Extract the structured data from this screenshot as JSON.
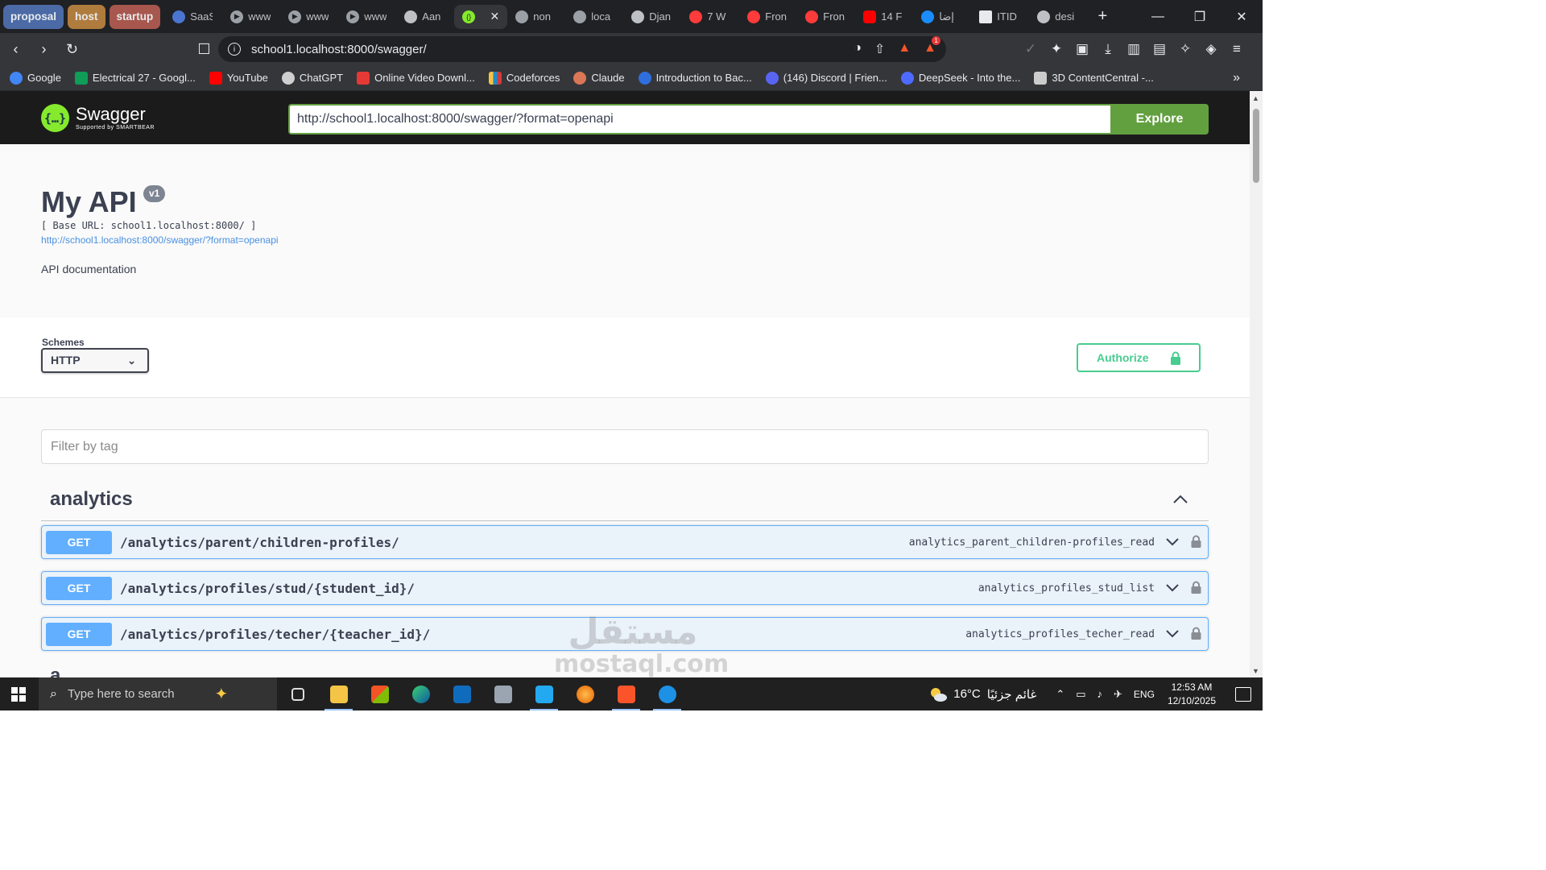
{
  "browser": {
    "tab_groups": [
      {
        "label": "proposal",
        "color": "#4b6aa6"
      },
      {
        "label": "host",
        "color": "#b07c3e"
      },
      {
        "label": "startup",
        "color": "#a7574d"
      }
    ],
    "tabs": [
      {
        "title": "SaaS",
        "icon": "saas-icon"
      },
      {
        "title": "www",
        "icon": "video-icon"
      },
      {
        "title": "www",
        "icon": "video-icon"
      },
      {
        "title": "www",
        "icon": "video-icon"
      },
      {
        "title": "Aan",
        "icon": "openai-icon"
      },
      {
        "title": "",
        "icon": "swagger-icon",
        "active": true
      },
      {
        "title": "non",
        "icon": "globe-icon"
      },
      {
        "title": "loca",
        "icon": "globe-icon"
      },
      {
        "title": "Djan",
        "icon": "openai-icon"
      },
      {
        "title": "7 W",
        "icon": "youtube-icon"
      },
      {
        "title": "Fron",
        "icon": "youtube-icon"
      },
      {
        "title": "Fron",
        "icon": "youtube-icon"
      },
      {
        "title": "14 F",
        "icon": "youtube-icon"
      },
      {
        "title": "إضا",
        "icon": "circle-icon"
      },
      {
        "title": "ITID",
        "icon": "itida-icon"
      },
      {
        "title": "desi",
        "icon": "openai-icon"
      }
    ],
    "url": "school1.localhost:8000/swagger/",
    "bookmarks": [
      {
        "label": "Google",
        "color": "#4285f4"
      },
      {
        "label": "Electrical 27 - Googl...",
        "color": "#0f9d58"
      },
      {
        "label": "YouTube",
        "color": "#ff0000"
      },
      {
        "label": "ChatGPT",
        "color": "#cfcfcf"
      },
      {
        "label": "Online Video Downl...",
        "color": "#e53935"
      },
      {
        "label": "Codeforces",
        "color": "#1f8acb"
      },
      {
        "label": "Claude",
        "color": "#d97757"
      },
      {
        "label": "Introduction to Bac...",
        "color": "#2f6fdd"
      },
      {
        "label": "(146) Discord | Frien...",
        "color": "#5865f2"
      },
      {
        "label": "DeepSeek - Into the...",
        "color": "#4d6bfe"
      },
      {
        "label": "3D ContentCentral -...",
        "color": "#cccccc"
      }
    ],
    "notification_badge": "1"
  },
  "swagger": {
    "brand": "Swagger",
    "supported_by": "Supported by SMARTBEAR",
    "spec_url_input": "http://school1.localhost:8000/swagger/?format=openapi",
    "explore_label": "Explore",
    "title": "My API",
    "version": "v1",
    "base_url": "[ Base URL: school1.localhost:8000/ ]",
    "spec_link": "http://school1.localhost:8000/swagger/?format=openapi",
    "description": "API documentation",
    "schemes_label": "Schemes",
    "scheme_selected": "HTTP",
    "authorize_label": "Authorize",
    "filter_placeholder": "Filter by tag",
    "tag": "analytics",
    "operations": [
      {
        "method": "GET",
        "path": "/analytics/parent/children-profiles/",
        "operation_id": "analytics_parent_children-profiles_read"
      },
      {
        "method": "GET",
        "path": "/analytics/profiles/stud/{student_id}/",
        "operation_id": "analytics_profiles_stud_list"
      },
      {
        "method": "GET",
        "path": "/analytics/profiles/techer/{teacher_id}/",
        "operation_id": "analytics_profiles_techer_read"
      }
    ],
    "next_tag_partial": "a",
    "colors": {
      "get": "#61affe",
      "accent_green": "#49cc90",
      "explore_green": "#62a03f",
      "logo_green": "#85ea2d"
    }
  },
  "watermark": {
    "arabic": "مستقل",
    "latin": "mostaql.com"
  },
  "taskbar": {
    "search_placeholder": "Type here to search",
    "apps": [
      "task-view-icon",
      "file-explorer-icon",
      "store-icon",
      "edge-icon",
      "outlook-icon",
      "screen-capture-icon",
      "vscode-icon",
      "firefox-icon",
      "brave-icon",
      "docker-icon"
    ],
    "temperature": "16°C",
    "weather_text": "غائم جزئيًا",
    "language": "ENG",
    "time": "12:53 AM",
    "date": "12/10/2025"
  }
}
